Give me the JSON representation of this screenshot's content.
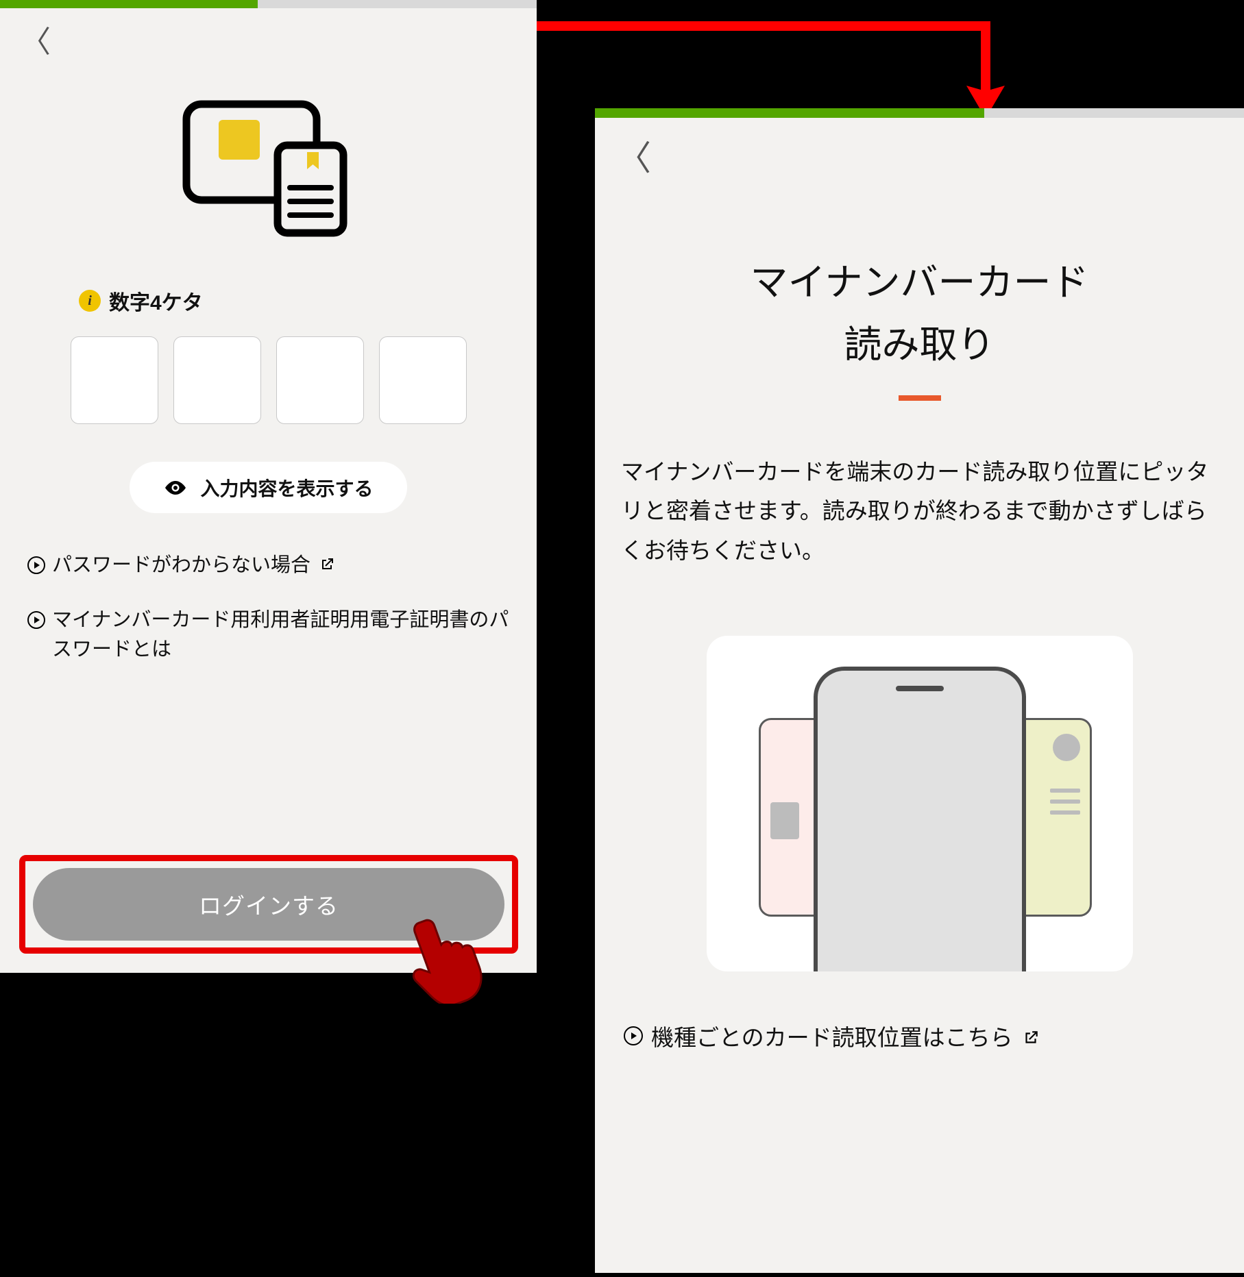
{
  "left": {
    "pin_label": "数字4ケタ",
    "show_content_label": "入力内容を表示する",
    "link_forgot": "パスワードがわからない場合",
    "link_about_password": "マイナンバーカード用利用者証明用電子証明書のパスワードとは",
    "login_button": "ログインする"
  },
  "right": {
    "title_line1": "マイナンバーカード",
    "title_line2": "読み取り",
    "description": "マイナンバーカードを端末のカード読み取り位置にピッタリと密着させます。読み取りが終わるまで動かさずしばらくお待ちください。",
    "positions_link": "機種ごとのカード読取位置はこちら"
  }
}
